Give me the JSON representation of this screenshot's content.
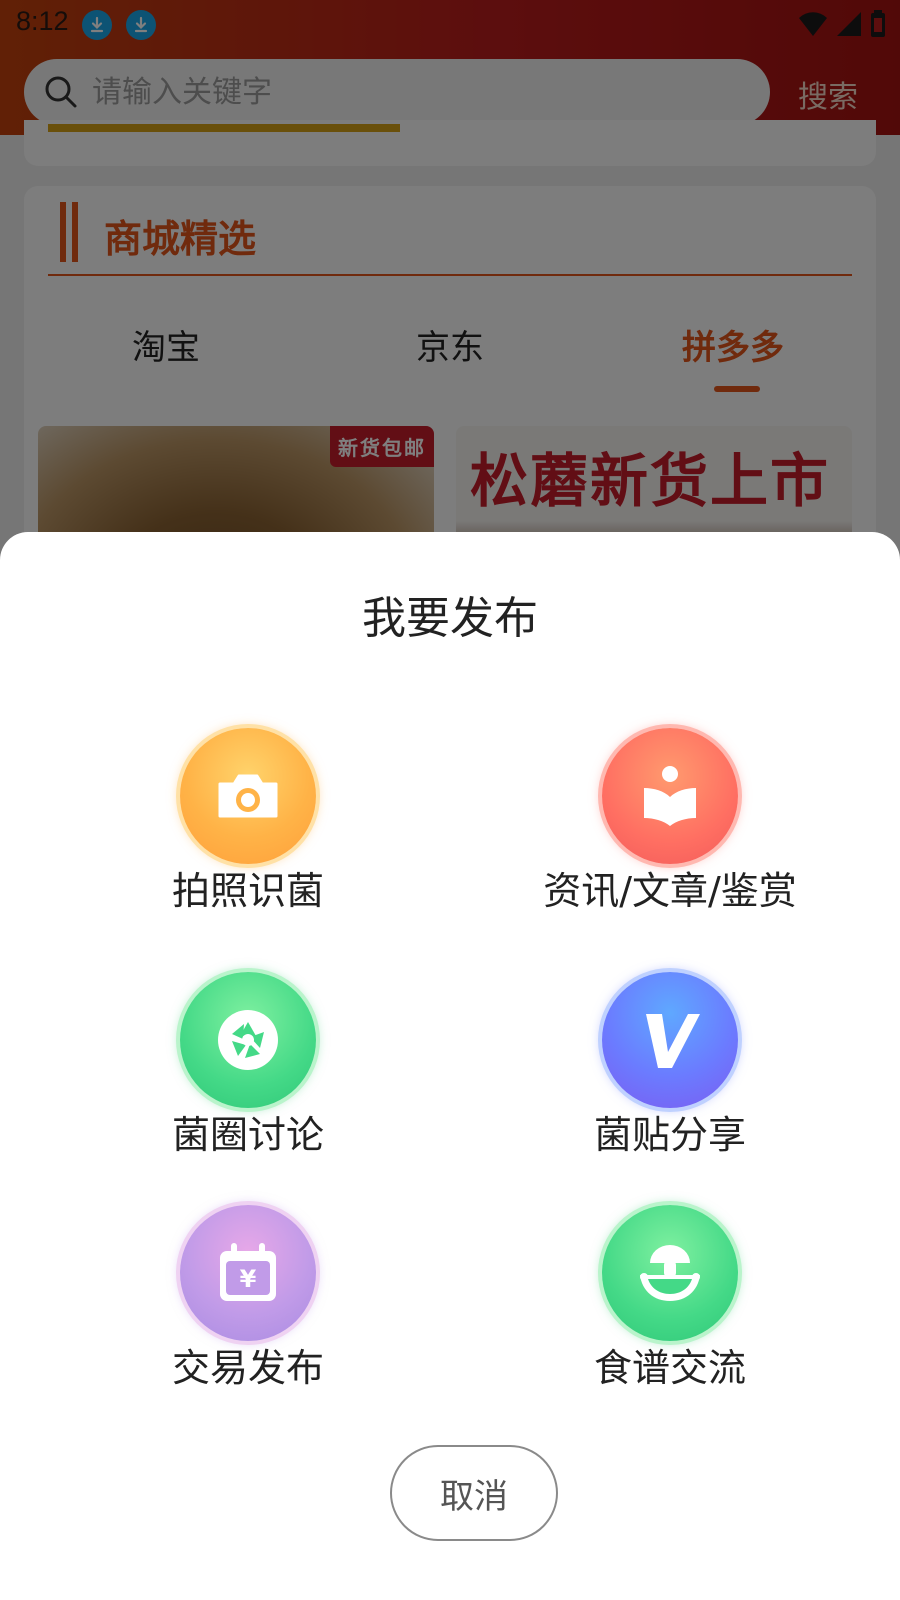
{
  "status_bar": {
    "time": "8:12"
  },
  "search": {
    "placeholder": "请输入关键字",
    "button_label": "搜索"
  },
  "section": {
    "title": "商城精选",
    "tabs": [
      {
        "label": "淘宝",
        "active": false
      },
      {
        "label": "京东",
        "active": false
      },
      {
        "label": "拼多多",
        "active": true
      }
    ]
  },
  "products": [
    {
      "badge": "新货包邮"
    },
    {
      "headline": "松蘑新货上市"
    }
  ],
  "sheet": {
    "title": "我要发布",
    "options": [
      {
        "label": "拍照识菌",
        "icon": "camera-icon",
        "color": "#ffb347"
      },
      {
        "label": "资讯/文章/鉴赏",
        "icon": "book-reader-icon",
        "color": "#ff6f62"
      },
      {
        "label": "菌圈讨论",
        "icon": "aperture-icon",
        "color": "#44d987"
      },
      {
        "label": "菌贴分享",
        "icon": "v-logo-icon",
        "color": "#6b7bff"
      },
      {
        "label": "交易发布",
        "icon": "calendar-yen-icon",
        "color": "#c19be8"
      },
      {
        "label": "食谱交流",
        "icon": "mushroom-bowl-icon",
        "color": "#44d987"
      }
    ],
    "cancel_label": "取消"
  },
  "colors": {
    "accent": "#e0541a",
    "header": "#b91c1c",
    "badge": "#c41d2a"
  }
}
